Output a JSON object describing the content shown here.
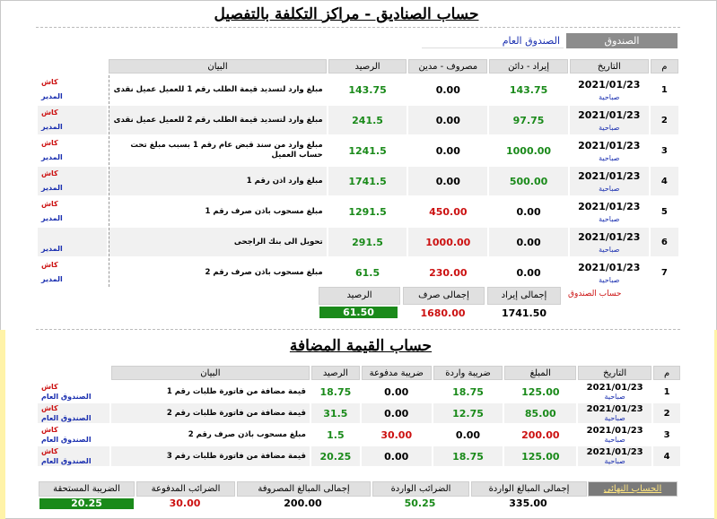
{
  "funds_title": "حساب الصناديق - مراكز التكلفة بالتفصيل",
  "fund_selector": {
    "label": "الصندوق",
    "value": "الصندوق العام"
  },
  "funds_table": {
    "headers": [
      "م",
      "التاريخ",
      "إيراد - دائن",
      "مصروف - مدين",
      "الرصيد",
      "البيان"
    ],
    "rows": [
      {
        "idx": "1",
        "date": "2021/01/23",
        "shift": "صباحية",
        "income": "143.75",
        "expense": "0.00",
        "balance": "143.75",
        "desc": "مبلغ وارد لتسديد قيمة الطلب رقم 1 للعميل عميل نقدى",
        "cash": "كاش",
        "mgr": "المدير"
      },
      {
        "idx": "2",
        "date": "2021/01/23",
        "shift": "صباحية",
        "income": "97.75",
        "expense": "0.00",
        "balance": "241.5",
        "desc": "مبلغ وارد لتسديد قيمة الطلب رقم 2 للعميل عميل نقدى",
        "cash": "كاش",
        "mgr": "المدير"
      },
      {
        "idx": "3",
        "date": "2021/01/23",
        "shift": "صباحية",
        "income": "1000.00",
        "expense": "0.00",
        "balance": "1241.5",
        "desc": "مبلغ وارد من سند قبض عام رقم 1 بسبب مبلغ تحت حساب العميل",
        "cash": "كاش",
        "mgr": "المدير"
      },
      {
        "idx": "4",
        "date": "2021/01/23",
        "shift": "صباحية",
        "income": "500.00",
        "expense": "0.00",
        "balance": "1741.5",
        "desc": "مبلغ وارد اذن رقم 1",
        "cash": "كاش",
        "mgr": "المدير"
      },
      {
        "idx": "5",
        "date": "2021/01/23",
        "shift": "صباحية",
        "income": "0.00",
        "expense": "450.00",
        "balance": "1291.5",
        "desc": "مبلغ مسحوب باذن صرف رقم 1",
        "cash": "كاش",
        "mgr": "المدير"
      },
      {
        "idx": "6",
        "date": "2021/01/23",
        "shift": "صباحية",
        "income": "0.00",
        "expense": "1000.00",
        "balance": "291.5",
        "desc": "تحويل الى بنك الراجحى",
        "cash": "",
        "mgr": "المدير"
      },
      {
        "idx": "7",
        "date": "2021/01/23",
        "shift": "صباحية",
        "income": "0.00",
        "expense": "230.00",
        "balance": "61.5",
        "desc": "مبلغ مسحوب باذن صرف رقم 2",
        "cash": "كاش",
        "mgr": "المدير"
      }
    ]
  },
  "funds_summary": {
    "link": "حساب الصندوق",
    "income_label": "إجمالى إيراد",
    "income": "1741.50",
    "expense_label": "إجمالى صرف",
    "expense": "1680.00",
    "balance_label": "الرصيد",
    "balance": "61.50"
  },
  "vat_title": "حساب القيمة المضافة",
  "vat_table": {
    "headers": [
      "م",
      "التاريخ",
      "المبلغ",
      "ضريبة واردة",
      "ضريبة مدفوعة",
      "الرصيد",
      "البيان"
    ],
    "rows": [
      {
        "idx": "1",
        "date": "2021/01/23",
        "shift": "صباحية",
        "amount": "125.00",
        "tax_in": "18.75",
        "tax_paid": "0.00",
        "balance": "18.75",
        "desc": "قيمة مضافة من فاتورة طلبات رقم 1",
        "cash": "كاش",
        "fund": "الصندوق العام"
      },
      {
        "idx": "2",
        "date": "2021/01/23",
        "shift": "صباحية",
        "amount": "85.00",
        "tax_in": "12.75",
        "tax_paid": "0.00",
        "balance": "31.5",
        "desc": "قيمة مضافة من فاتورة طلبات رقم 2",
        "cash": "كاش",
        "fund": "الصندوق العام"
      },
      {
        "idx": "3",
        "date": "2021/01/23",
        "shift": "صباحية",
        "amount": "200.00",
        "tax_in": "0.00",
        "tax_paid": "30.00",
        "balance": "1.5",
        "desc": "مبلغ مسحوب باذن صرف رقم 2",
        "cash": "كاش",
        "fund": "الصندوق العام"
      },
      {
        "idx": "4",
        "date": "2021/01/23",
        "shift": "صباحية",
        "amount": "125.00",
        "tax_in": "18.75",
        "tax_paid": "0.00",
        "balance": "20.25",
        "desc": "قيمة مضافة من فاتورة طلبات رقم 3",
        "cash": "كاش",
        "fund": "الصندوق العام"
      }
    ]
  },
  "vat_totals": {
    "final_label": "الحساب النهائى",
    "amount_in_label": "إجمالى المبالغ الواردة",
    "amount_in": "335.00",
    "tax_in_label": "الضرائب الواردة",
    "tax_in": "50.25",
    "amount_out_label": "إجمالى المبالغ المصروفة",
    "amount_out": "200.00",
    "tax_paid_label": "الضرائب المدفوعة",
    "tax_paid": "30.00",
    "tax_due_label": "الضريبة المستحقة",
    "tax_due": "20.25"
  },
  "colors": {
    "green": "#1a8a1a",
    "red": "#cc1111",
    "blue": "#1a2fb0",
    "header_gray": "#e0e0e0"
  }
}
